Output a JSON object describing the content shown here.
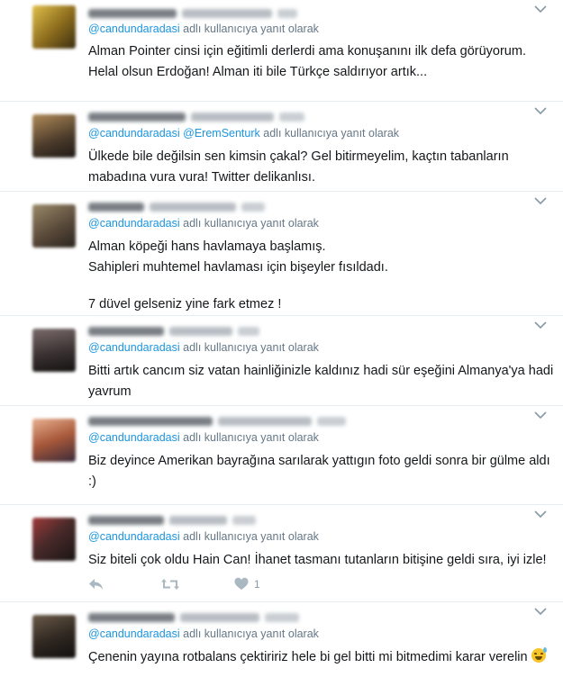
{
  "reply_context": {
    "suffix": "adlı kullanıcıya yanıt olarak"
  },
  "replies": [
    {
      "mentions": [
        "@candundaradasi"
      ],
      "lines": [
        "Alman Pointer cinsi için eğitimli derlerdi ama konuşanını ilk defa görüyorum.",
        "Helal olsun Erdoğan! Alman iti bile Türkçe saldırıyor artık..."
      ],
      "avatar_color": "#c9a23a"
    },
    {
      "mentions": [
        "@candundaradasi",
        "@EremSenturk"
      ],
      "lines": [
        "Ülkede bile değilsin sen kimsin çakal? Gel bitirmeyelim, kaçtın tabanların",
        "mabadına vura vura! Twitter delikanlısı."
      ],
      "avatar_color": "#6b5a4a"
    },
    {
      "mentions": [
        "@candundaradasi"
      ],
      "lines": [
        "Alman köpeği hans havlamaya başlamış.",
        "Sahipleri muhtemel havlaması için bişeyler fısıldadı.",
        "",
        "7 düvel gelseniz yine fark etmez !"
      ],
      "avatar_color": "#5d4f3e"
    },
    {
      "mentions": [
        "@candundaradasi"
      ],
      "lines": [
        "Bitti artık cancım siz vatan hainliğinizle kaldınız hadi sür eşeğini Almanya'ya hadi",
        "yavrum"
      ],
      "avatar_color": "#3e3a3a"
    },
    {
      "mentions": [
        "@candundaradasi"
      ],
      "lines": [
        "Biz deyince Amerikan bayrağına sarılarak yattıgın foto geldi sonra bir gülme aldı",
        ":)"
      ],
      "avatar_color": "#b8603d"
    },
    {
      "mentions": [
        "@candundaradasi"
      ],
      "lines": [
        "Siz biteli çok oldu Hain Can! İhanet tasmanı tutanların bitişine geldi sıra, iyi izle!"
      ],
      "avatar_color": "#3b2b2b",
      "actions": {
        "reply_icon": "reply-icon",
        "retweet_icon": "retweet-icon",
        "like_icon": "heart-icon",
        "like_count": "1"
      }
    },
    {
      "mentions": [
        "@candundaradasi"
      ],
      "lines": [
        "Çenenin yayına rotbalans çektiririz hele bi gel bitti mi bitmedimi karar verelin"
      ],
      "avatar_color": "#2e2a26",
      "trailing_emoji": "grinning-sweat-emoji"
    }
  ],
  "colors": {
    "link": "#1b95e0",
    "muted": "#657786",
    "text": "#14171a",
    "action": "#aab8c2",
    "divider": "#e6ecf0"
  }
}
